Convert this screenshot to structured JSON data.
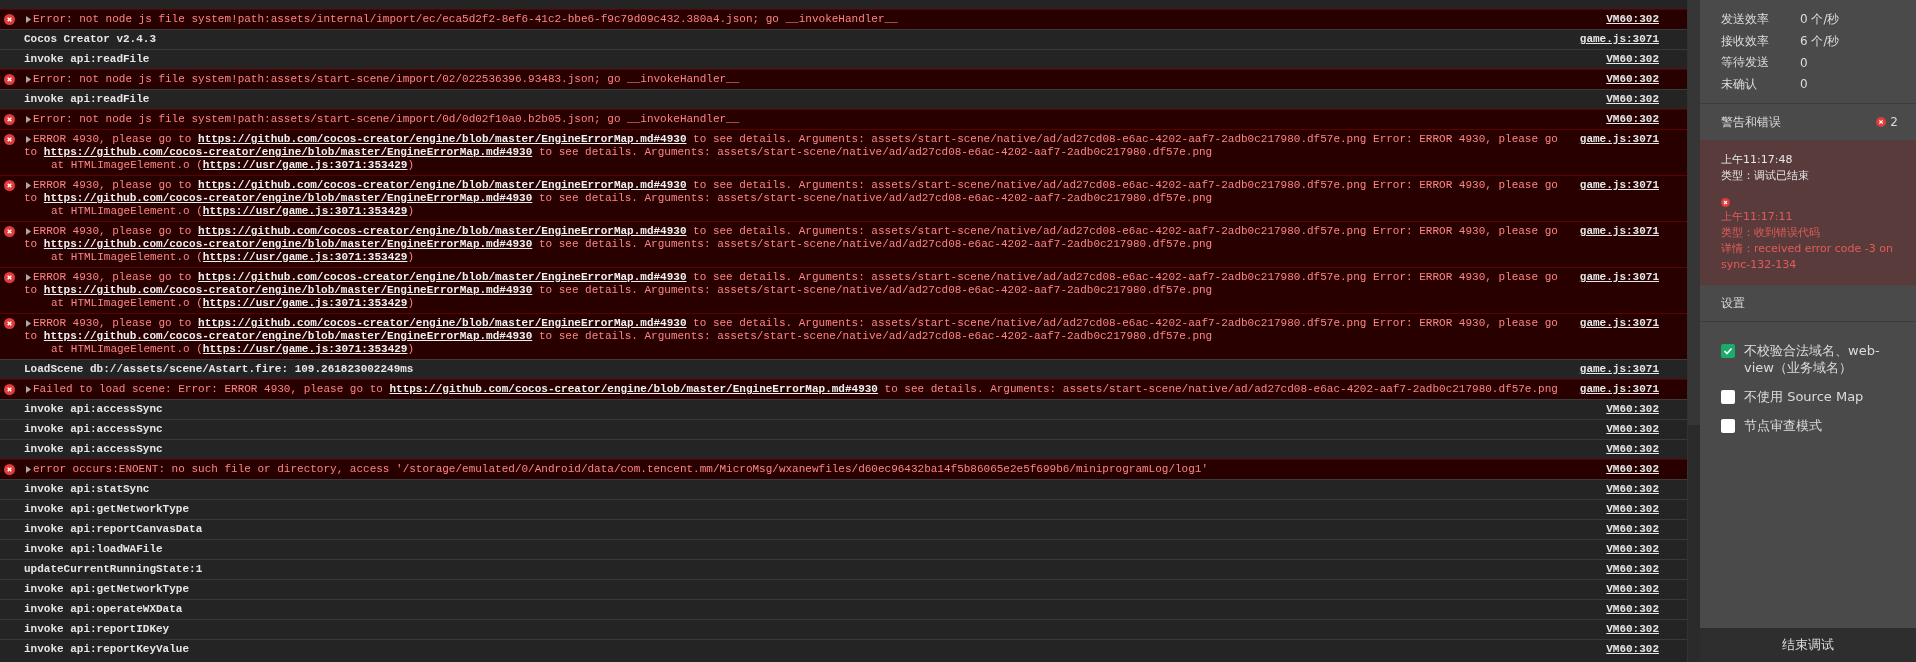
{
  "console": {
    "rows": [
      {
        "kind": "error",
        "lines": [
          [
            {
              "kind": "text",
              "text": "Error: not node js file system!path:assets/internal/import/ec/eca5d2f2-8ef6-41c2-bbe6-f9c79d09c432.380a4.json; go __invokeHandler__"
            }
          ]
        ],
        "source": "VM60:302"
      },
      {
        "kind": "log",
        "lines": [
          [
            {
              "kind": "text",
              "text": "Cocos Creator v2.4.3"
            }
          ]
        ],
        "source": "game.js:3071"
      },
      {
        "kind": "log",
        "lines": [
          [
            {
              "kind": "text",
              "text": "invoke api:readFile"
            }
          ]
        ],
        "source": "VM60:302"
      },
      {
        "kind": "error",
        "lines": [
          [
            {
              "kind": "text",
              "text": "Error: not node js file system!path:assets/start-scene/import/02/022536396.93483.json; go __invokeHandler__"
            }
          ]
        ],
        "source": "VM60:302"
      },
      {
        "kind": "log",
        "lines": [
          [
            {
              "kind": "text",
              "text": "invoke api:readFile"
            }
          ]
        ],
        "source": "VM60:302"
      },
      {
        "kind": "error",
        "lines": [
          [
            {
              "kind": "text",
              "text": "Error: not node js file system!path:assets/start-scene/import/0d/0d02f10a0.b2b05.json; go __invokeHandler__"
            }
          ]
        ],
        "source": "VM60:302"
      },
      {
        "kind": "error",
        "lines": [
          [
            {
              "kind": "text",
              "text": "ERROR 4930, please go to "
            },
            {
              "kind": "link",
              "text": "https://github.com/cocos-creator/engine/blob/master/EngineErrorMap.md#4930"
            },
            {
              "kind": "text",
              "text": " to see details. Arguments: assets/start-scene/native/ad/ad27cd08-e6ac-4202-aaf7-2adb0c217980.df57e.png Error: ERROR 4930, please go"
            }
          ],
          [
            {
              "kind": "text",
              "text": "to "
            },
            {
              "kind": "link",
              "text": "https://github.com/cocos-creator/engine/blob/master/EngineErrorMap.md#4930"
            },
            {
              "kind": "text",
              "text": " to see details. Arguments: assets/start-scene/native/ad/ad27cd08-e6ac-4202-aaf7-2adb0c217980.df57e.png"
            }
          ]
        ],
        "stack": [
          [
            {
              "kind": "text",
              "text": "at HTMLImageElement.o ("
            },
            {
              "kind": "link",
              "text": "https://usr/game.js:3071:353429"
            },
            {
              "kind": "text",
              "text": ")"
            }
          ]
        ],
        "source": "game.js:3071"
      },
      {
        "kind": "error",
        "lines": [
          [
            {
              "kind": "text",
              "text": "ERROR 4930, please go to "
            },
            {
              "kind": "link",
              "text": "https://github.com/cocos-creator/engine/blob/master/EngineErrorMap.md#4930"
            },
            {
              "kind": "text",
              "text": " to see details. Arguments: assets/start-scene/native/ad/ad27cd08-e6ac-4202-aaf7-2adb0c217980.df57e.png Error: ERROR 4930, please go"
            }
          ],
          [
            {
              "kind": "text",
              "text": "to "
            },
            {
              "kind": "link",
              "text": "https://github.com/cocos-creator/engine/blob/master/EngineErrorMap.md#4930"
            },
            {
              "kind": "text",
              "text": " to see details. Arguments: assets/start-scene/native/ad/ad27cd08-e6ac-4202-aaf7-2adb0c217980.df57e.png"
            }
          ]
        ],
        "stack": [
          [
            {
              "kind": "text",
              "text": "at HTMLImageElement.o ("
            },
            {
              "kind": "link",
              "text": "https://usr/game.js:3071:353429"
            },
            {
              "kind": "text",
              "text": ")"
            }
          ]
        ],
        "source": "game.js:3071"
      },
      {
        "kind": "error",
        "lines": [
          [
            {
              "kind": "text",
              "text": "ERROR 4930, please go to "
            },
            {
              "kind": "link",
              "text": "https://github.com/cocos-creator/engine/blob/master/EngineErrorMap.md#4930"
            },
            {
              "kind": "text",
              "text": " to see details. Arguments: assets/start-scene/native/ad/ad27cd08-e6ac-4202-aaf7-2adb0c217980.df57e.png Error: ERROR 4930, please go"
            }
          ],
          [
            {
              "kind": "text",
              "text": "to "
            },
            {
              "kind": "link",
              "text": "https://github.com/cocos-creator/engine/blob/master/EngineErrorMap.md#4930"
            },
            {
              "kind": "text",
              "text": " to see details. Arguments: assets/start-scene/native/ad/ad27cd08-e6ac-4202-aaf7-2adb0c217980.df57e.png"
            }
          ]
        ],
        "stack": [
          [
            {
              "kind": "text",
              "text": "at HTMLImageElement.o ("
            },
            {
              "kind": "link",
              "text": "https://usr/game.js:3071:353429"
            },
            {
              "kind": "text",
              "text": ")"
            }
          ]
        ],
        "source": "game.js:3071"
      },
      {
        "kind": "error",
        "lines": [
          [
            {
              "kind": "text",
              "text": "ERROR 4930, please go to "
            },
            {
              "kind": "link",
              "text": "https://github.com/cocos-creator/engine/blob/master/EngineErrorMap.md#4930"
            },
            {
              "kind": "text",
              "text": " to see details. Arguments: assets/start-scene/native/ad/ad27cd08-e6ac-4202-aaf7-2adb0c217980.df57e.png Error: ERROR 4930, please go"
            }
          ],
          [
            {
              "kind": "text",
              "text": "to "
            },
            {
              "kind": "link",
              "text": "https://github.com/cocos-creator/engine/blob/master/EngineErrorMap.md#4930"
            },
            {
              "kind": "text",
              "text": " to see details. Arguments: assets/start-scene/native/ad/ad27cd08-e6ac-4202-aaf7-2adb0c217980.df57e.png"
            }
          ]
        ],
        "stack": [
          [
            {
              "kind": "text",
              "text": "at HTMLImageElement.o ("
            },
            {
              "kind": "link",
              "text": "https://usr/game.js:3071:353429"
            },
            {
              "kind": "text",
              "text": ")"
            }
          ]
        ],
        "source": "game.js:3071"
      },
      {
        "kind": "error",
        "lines": [
          [
            {
              "kind": "text",
              "text": "ERROR 4930, please go to "
            },
            {
              "kind": "link",
              "text": "https://github.com/cocos-creator/engine/blob/master/EngineErrorMap.md#4930"
            },
            {
              "kind": "text",
              "text": " to see details. Arguments: assets/start-scene/native/ad/ad27cd08-e6ac-4202-aaf7-2adb0c217980.df57e.png Error: ERROR 4930, please go"
            }
          ],
          [
            {
              "kind": "text",
              "text": "to "
            },
            {
              "kind": "link",
              "text": "https://github.com/cocos-creator/engine/blob/master/EngineErrorMap.md#4930"
            },
            {
              "kind": "text",
              "text": " to see details. Arguments: assets/start-scene/native/ad/ad27cd08-e6ac-4202-aaf7-2adb0c217980.df57e.png"
            }
          ]
        ],
        "stack": [
          [
            {
              "kind": "text",
              "text": "at HTMLImageElement.o ("
            },
            {
              "kind": "link",
              "text": "https://usr/game.js:3071:353429"
            },
            {
              "kind": "text",
              "text": ")"
            }
          ]
        ],
        "source": "game.js:3071"
      },
      {
        "kind": "log",
        "lines": [
          [
            {
              "kind": "text",
              "text": "LoadScene db://assets/scene/Astart.fire: 109.261823002249ms"
            }
          ]
        ],
        "source": "game.js:3071"
      },
      {
        "kind": "error",
        "lines": [
          [
            {
              "kind": "text",
              "text": "Failed to load scene: Error: ERROR 4930, please go to "
            },
            {
              "kind": "link",
              "text": "https://github.com/cocos-creator/engine/blob/master/EngineErrorMap.md#4930"
            },
            {
              "kind": "text",
              "text": " to see details. Arguments: assets/start-scene/native/ad/ad27cd08-e6ac-4202-aaf7-2adb0c217980.df57e.png"
            }
          ]
        ],
        "source": "game.js:3071"
      },
      {
        "kind": "log",
        "lines": [
          [
            {
              "kind": "text",
              "text": "invoke api:accessSync"
            }
          ]
        ],
        "source": "VM60:302"
      },
      {
        "kind": "log",
        "lines": [
          [
            {
              "kind": "text",
              "text": "invoke api:accessSync"
            }
          ]
        ],
        "source": "VM60:302"
      },
      {
        "kind": "log",
        "lines": [
          [
            {
              "kind": "text",
              "text": "invoke api:accessSync"
            }
          ]
        ],
        "source": "VM60:302"
      },
      {
        "kind": "error",
        "lines": [
          [
            {
              "kind": "text",
              "text": "error occurs:ENOENT: no such file or directory, access '/storage/emulated/0/Android/data/com.tencent.mm/MicroMsg/wxanewfiles/d60ec96432ba14f5b86065e2e5f699b6/miniprogramLog/log1'"
            }
          ]
        ],
        "source": "VM60:302"
      },
      {
        "kind": "log",
        "lines": [
          [
            {
              "kind": "text",
              "text": "invoke api:statSync"
            }
          ]
        ],
        "source": "VM60:302"
      },
      {
        "kind": "log",
        "lines": [
          [
            {
              "kind": "text",
              "text": "invoke api:getNetworkType"
            }
          ]
        ],
        "source": "VM60:302"
      },
      {
        "kind": "log",
        "lines": [
          [
            {
              "kind": "text",
              "text": "invoke api:reportCanvasData"
            }
          ]
        ],
        "source": "VM60:302"
      },
      {
        "kind": "log",
        "lines": [
          [
            {
              "kind": "text",
              "text": "invoke api:loadWAFile"
            }
          ]
        ],
        "source": "VM60:302"
      },
      {
        "kind": "log",
        "lines": [
          [
            {
              "kind": "text",
              "text": "updateCurrentRunningState:1"
            }
          ]
        ],
        "source": "VM60:302"
      },
      {
        "kind": "log",
        "lines": [
          [
            {
              "kind": "text",
              "text": "invoke api:getNetworkType"
            }
          ]
        ],
        "source": "VM60:302"
      },
      {
        "kind": "log",
        "lines": [
          [
            {
              "kind": "text",
              "text": "invoke api:operateWXData"
            }
          ]
        ],
        "source": "VM60:302"
      },
      {
        "kind": "log",
        "lines": [
          [
            {
              "kind": "text",
              "text": "invoke api:reportIDKey"
            }
          ]
        ],
        "source": "VM60:302"
      },
      {
        "kind": "log",
        "lines": [
          [
            {
              "kind": "text",
              "text": "invoke api:reportKeyValue"
            }
          ]
        ],
        "source": "VM60:302"
      }
    ]
  },
  "sidebar": {
    "stats": [
      {
        "label": "发送效率",
        "value": "0 个/秒"
      },
      {
        "label": "接收效率",
        "value": "6 个/秒"
      },
      {
        "label": "等待发送",
        "value": "0"
      },
      {
        "label": "未确认",
        "value": "0"
      }
    ],
    "warnings": {
      "title": "警告和错误",
      "count": "2",
      "entries": [
        {
          "kind": "info",
          "lines": [
            "上午11:17:48",
            "类型：调试已结束"
          ]
        },
        {
          "kind": "error",
          "lines": [
            "上午11:17:11",
            "类型：收到错误代码",
            "详情：received error code -3 on sync-132-134"
          ]
        }
      ]
    },
    "settings": {
      "title": "设置",
      "options": [
        {
          "label": "不校验合法域名、web-view（业务域名）",
          "checked": true
        },
        {
          "label": "不使用 Source Map",
          "checked": false
        },
        {
          "label": "节点审查模式",
          "checked": false
        }
      ]
    },
    "end_button": "结束调试"
  }
}
